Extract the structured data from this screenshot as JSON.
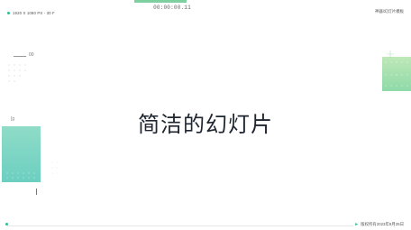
{
  "header": {
    "resolution_label": "1920 X 1080 PX - 30 F",
    "timecode": "00:00:00.11",
    "brand_label": "神器/幻灯片模板"
  },
  "left_panel": {
    "number": "00",
    "tick_label": "[g"
  },
  "slide": {
    "title": "简洁的幻灯片"
  },
  "footer": {
    "copyright": "版权所有2023年9月25日"
  },
  "colors": {
    "accent": "#2fbf8f",
    "teal": "#6ccfc0",
    "mint": "#8ed9a8",
    "text": "#1f2630"
  },
  "icons": {
    "status_dot": "status-dot-icon",
    "arrow": "arrow-right-icon"
  }
}
